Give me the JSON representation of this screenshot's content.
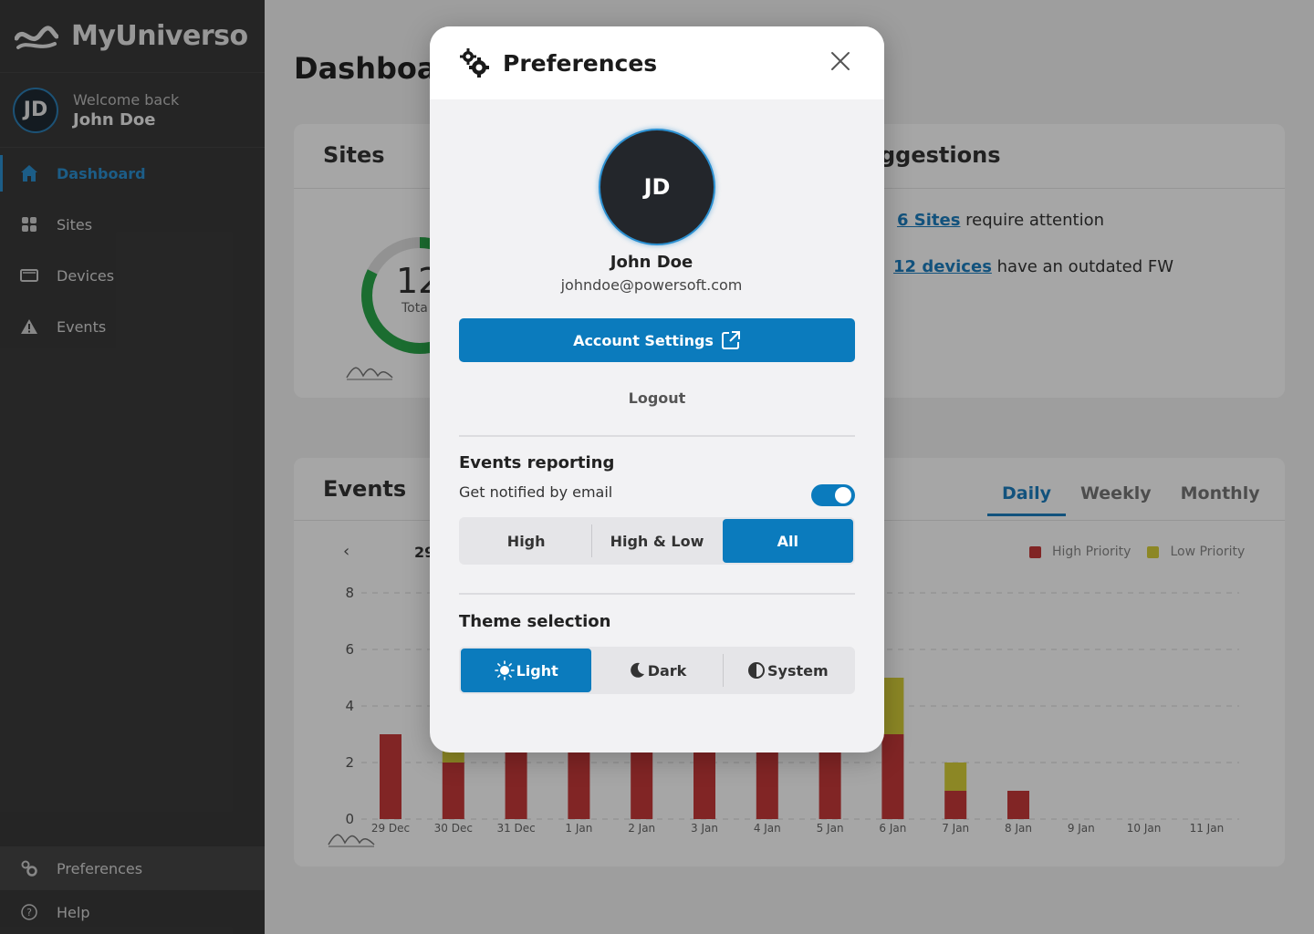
{
  "app": {
    "name": "MyUniverso"
  },
  "user": {
    "initials": "JD",
    "welcome": "Welcome back",
    "name": "John Doe",
    "email": "johndoe@powersoft.com"
  },
  "sidebar": {
    "items": [
      {
        "label": "Dashboard",
        "icon": "home-icon",
        "active": true
      },
      {
        "label": "Sites",
        "icon": "grid-icon"
      },
      {
        "label": "Devices",
        "icon": "device-icon"
      },
      {
        "label": "Events",
        "icon": "warning-icon"
      }
    ],
    "bottom": [
      {
        "label": "Preferences",
        "icon": "gears-icon"
      },
      {
        "label": "Help",
        "icon": "help-icon"
      }
    ]
  },
  "main": {
    "page_title": "Dashboar",
    "sites_card": {
      "title": "Sites",
      "total_value": "12",
      "total_label": "Tota"
    },
    "suggestions_card": {
      "title": "ggestions",
      "lines": [
        {
          "link": "6 Sites",
          "text": " require attention"
        },
        {
          "link": "12 devices",
          "text": " have an outdated FW"
        }
      ]
    },
    "events_card": {
      "title": "Events",
      "tabs": [
        "Daily",
        "Weekly",
        "Monthly"
      ],
      "active_tab": "Daily",
      "date_nav": "29",
      "legend": [
        {
          "label": "High Priority",
          "color": "#c73a3a"
        },
        {
          "label": "Low Priority",
          "color": "#d8cf3a"
        }
      ]
    }
  },
  "chart_data": {
    "type": "bar",
    "categories": [
      "29 Dec",
      "30 Dec",
      "31 Dec",
      "1 Jan",
      "2 Jan",
      "3 Jan",
      "4 Jan",
      "5 Jan",
      "6 Jan",
      "7 Jan",
      "8 Jan",
      "9 Jan",
      "10 Jan",
      "11 Jan"
    ],
    "series": [
      {
        "name": "High Priority",
        "values": [
          3,
          2,
          3,
          3,
          3,
          3,
          3,
          3,
          3,
          1,
          1,
          0,
          0,
          0
        ]
      },
      {
        "name": "Low Priority",
        "values": [
          0,
          1,
          0,
          0,
          0,
          0,
          0,
          0,
          2,
          1,
          0,
          0,
          0,
          0
        ]
      }
    ],
    "stacked": true,
    "yticks": [
      "0",
      "2",
      "4",
      "6",
      "8"
    ],
    "ylim": [
      0,
      8
    ],
    "grid": true,
    "legend_position": "top-right"
  },
  "modal": {
    "title": "Preferences",
    "account_settings": "Account Settings",
    "logout": "Logout",
    "events_reporting": {
      "title": "Events reporting",
      "notify_label": "Get notified by email",
      "notify_enabled": true,
      "options": [
        "High",
        "High & Low",
        "All"
      ],
      "selected": "All"
    },
    "theme": {
      "title": "Theme selection",
      "options": [
        "Light",
        "Dark",
        "System"
      ],
      "selected": "Light"
    }
  }
}
